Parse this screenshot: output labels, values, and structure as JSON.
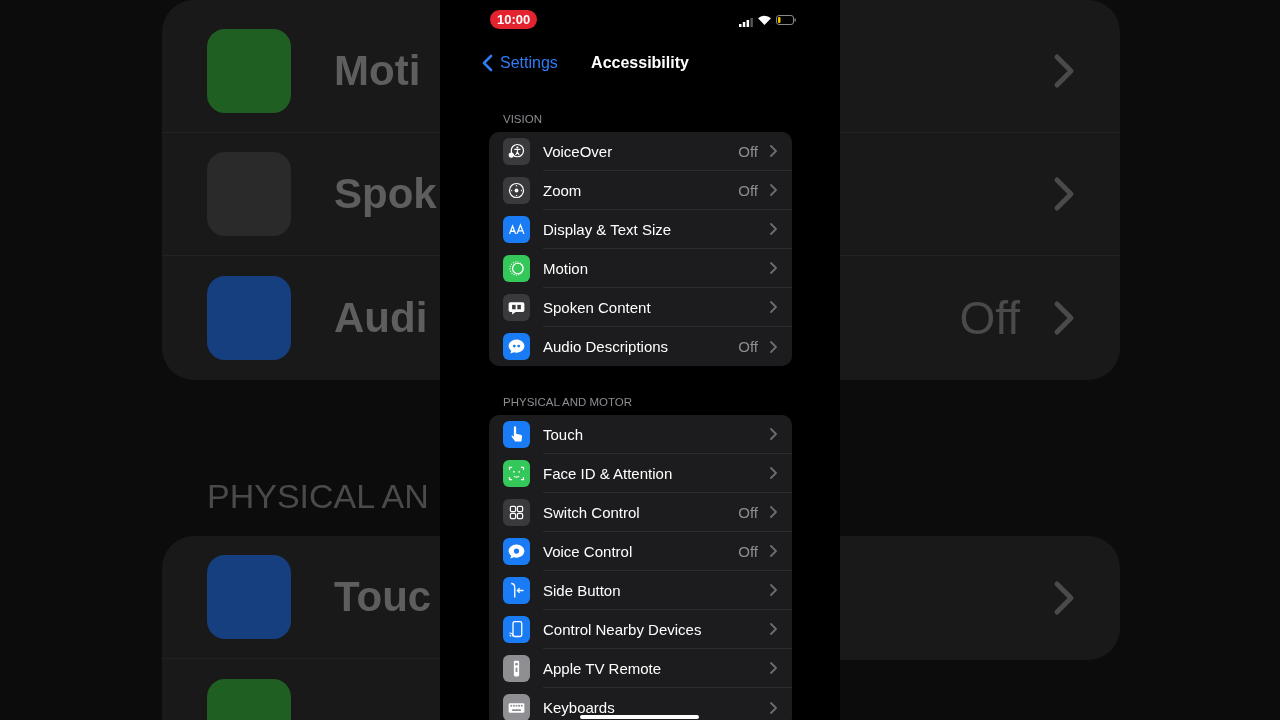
{
  "backdrop": {
    "rows": [
      {
        "label": "Moti"
      },
      {
        "label": "Spok"
      },
      {
        "label": "Audi",
        "value": "Off"
      }
    ],
    "section_header": "PHYSICAL AN",
    "rows_2": [
      {
        "label": "Touc"
      }
    ]
  },
  "status_bar": {
    "time": "10:00"
  },
  "nav": {
    "back": "Settings",
    "title": "Accessibility"
  },
  "sections": [
    {
      "header": "VISION",
      "items": [
        {
          "label": "VoiceOver",
          "value": "Off"
        },
        {
          "label": "Zoom",
          "value": "Off"
        },
        {
          "label": "Display & Text Size"
        },
        {
          "label": "Motion"
        },
        {
          "label": "Spoken Content"
        },
        {
          "label": "Audio Descriptions",
          "value": "Off"
        }
      ]
    },
    {
      "header": "PHYSICAL AND MOTOR",
      "items": [
        {
          "label": "Touch"
        },
        {
          "label": "Face ID & Attention"
        },
        {
          "label": "Switch Control",
          "value": "Off"
        },
        {
          "label": "Voice Control",
          "value": "Off"
        },
        {
          "label": "Side Button"
        },
        {
          "label": "Control Nearby Devices"
        },
        {
          "label": "Apple TV Remote"
        },
        {
          "label": "Keyboards"
        }
      ]
    }
  ]
}
